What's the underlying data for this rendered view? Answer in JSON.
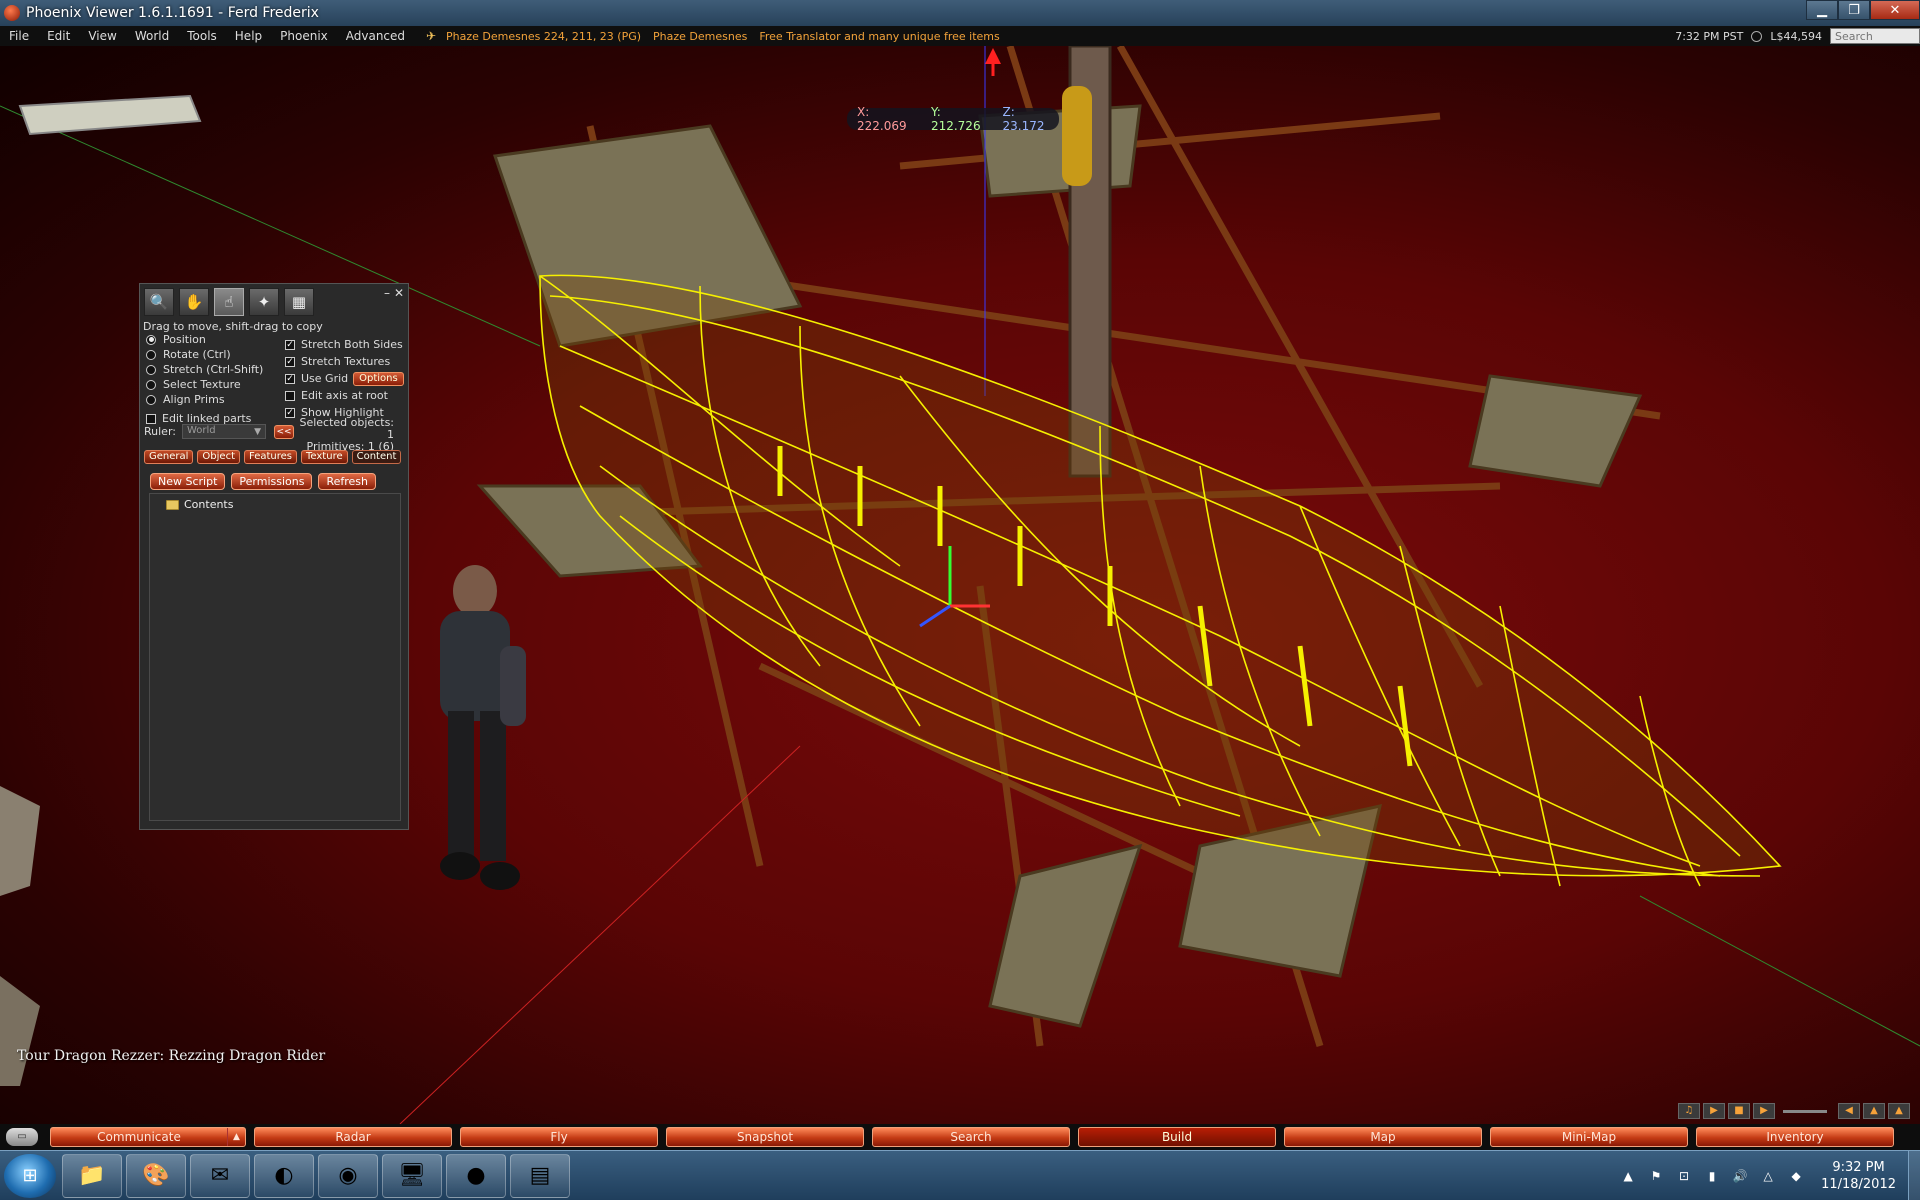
{
  "window": {
    "title": "Phoenix Viewer 1.6.1.1691 - Ferd Frederix",
    "controls": {
      "minimize": "▁",
      "maximize": "❐",
      "close": "✕"
    }
  },
  "menu": {
    "items": [
      "File",
      "Edit",
      "View",
      "World",
      "Tools",
      "Help",
      "Phoenix",
      "Advanced"
    ],
    "location": [
      "Phaze Demesnes 224, 211, 23 (PG)",
      "Phaze Demesnes",
      "Free Translator and many unique free items"
    ],
    "time": "7:32 PM PST",
    "balance": "L$44,594",
    "search_placeholder": "Search"
  },
  "coords": {
    "x": "X: 222.069",
    "y": "Y: 212.726",
    "z": "Z: 23.172"
  },
  "build_panel": {
    "hint": "Drag to move, shift-drag to copy",
    "modes": [
      "Position",
      "Rotate (Ctrl)",
      "Stretch (Ctrl-Shift)",
      "Select Texture",
      "Align Prims"
    ],
    "checks": [
      {
        "label": "Stretch Both Sides",
        "checked": true
      },
      {
        "label": "Stretch Textures",
        "checked": true
      },
      {
        "label": "Use Grid",
        "checked": true
      },
      {
        "label": "Edit axis at root",
        "checked": false
      },
      {
        "label": "Show Highlight",
        "checked": true
      }
    ],
    "options_label": "Options",
    "edit_linked": "Edit linked parts",
    "ruler_label": "Ruler:",
    "ruler_value": "World",
    "collapse_label": "<<",
    "selected_objects": "Selected objects: 1",
    "primitives": "Primitives: 1 (6)",
    "tabs": [
      "General",
      "Object",
      "Features",
      "Texture",
      "Content"
    ],
    "active_tab": "Content",
    "actions": [
      "New Script",
      "Permissions",
      "Refresh"
    ],
    "tree": [
      "Contents"
    ]
  },
  "chat_line": "Tour  Dragon Rezzer: Rezzing Dragon Rider",
  "bottom_bar": [
    "Communicate",
    "Radar",
    "Fly",
    "Snapshot",
    "Search",
    "Build",
    "Map",
    "Mini-Map",
    "Inventory"
  ],
  "taskbar": {
    "time": "9:32 PM",
    "date": "11/18/2012"
  }
}
